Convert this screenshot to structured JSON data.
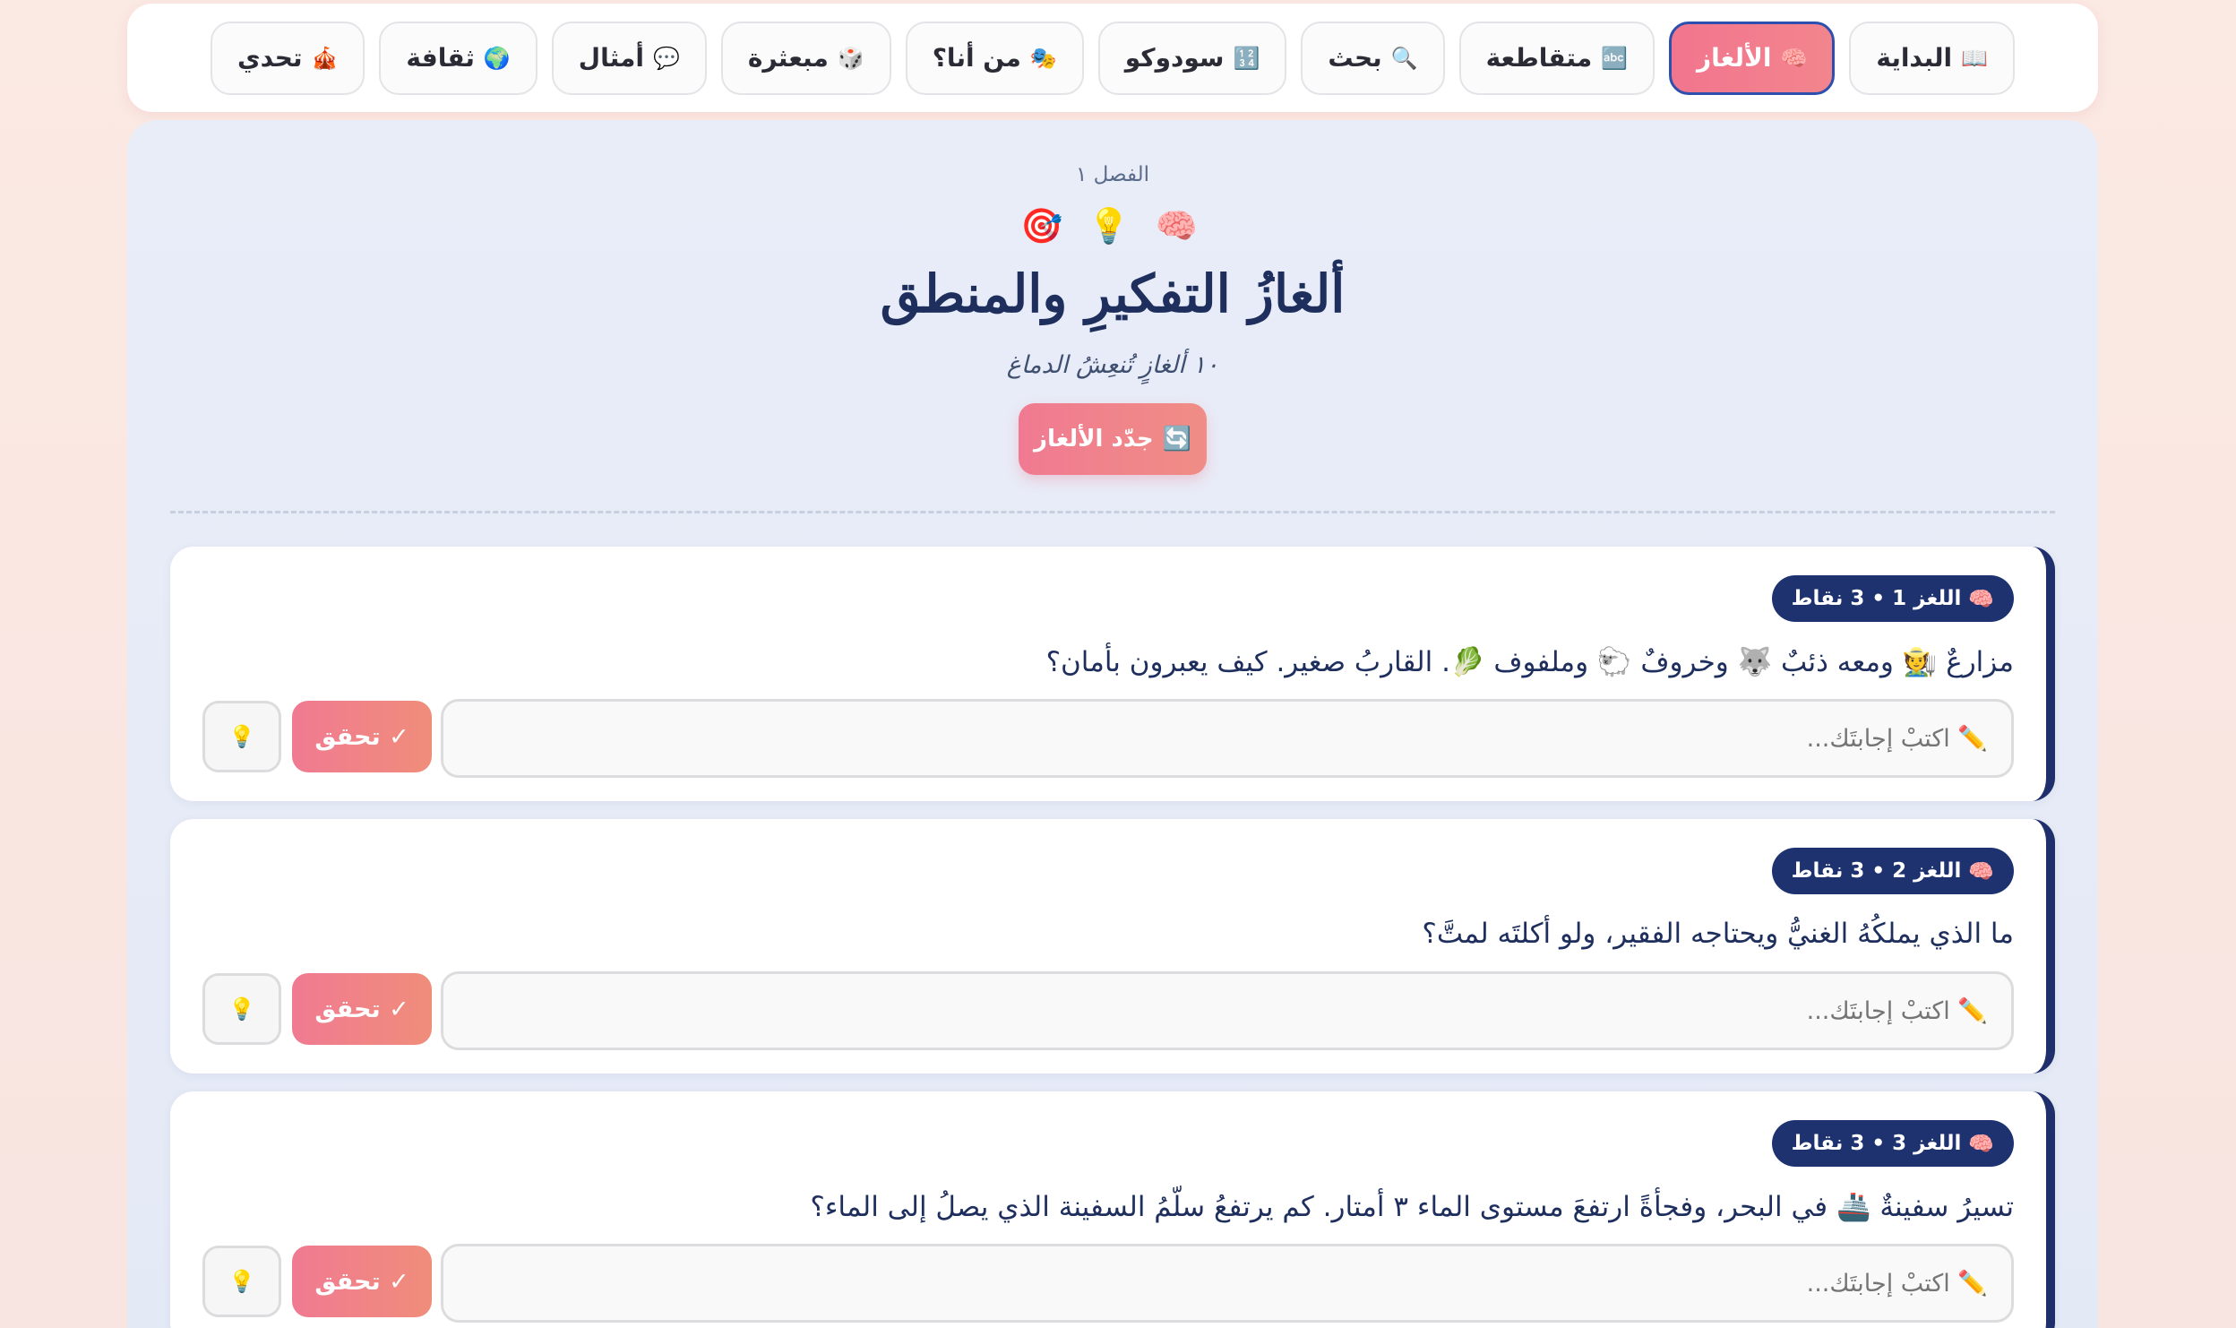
{
  "nav": {
    "items": [
      {
        "icon": "📖",
        "label": "البداية",
        "active": false
      },
      {
        "icon": "🧠",
        "label": "الألغاز",
        "active": true
      },
      {
        "icon": "🔤",
        "label": "متقاطعة",
        "active": false
      },
      {
        "icon": "🔍",
        "label": "بحث",
        "active": false
      },
      {
        "icon": "🔢",
        "label": "سودوكو",
        "active": false
      },
      {
        "icon": "🎭",
        "label": "من أنا؟",
        "active": false
      },
      {
        "icon": "🎲",
        "label": "مبعثرة",
        "active": false
      },
      {
        "icon": "💬",
        "label": "أمثال",
        "active": false
      },
      {
        "icon": "🌍",
        "label": "ثقافة",
        "active": false
      },
      {
        "icon": "🎪",
        "label": "تحدي",
        "active": false
      }
    ]
  },
  "header": {
    "chapter": "الفصل ١",
    "emojis": "🧠 💡 🎯",
    "title": "ألغازُ التفكيرِ والمنطق",
    "subtitle": "١٠ ألغازٍ تُنعِشُ الدماغ",
    "refresh_icon": "🔄",
    "refresh_label": "جدّد الألغاز"
  },
  "riddles": [
    {
      "badge_icon": "🧠",
      "badge": "اللغز 1 • 3 نقاط",
      "question": "مزارعٌ 🧑‍🌾 ومعه ذئبٌ 🐺 وخروفٌ 🐑 وملفوف 🥬. القاربُ صغير. كيف يعبرون بأمان؟",
      "placeholder": "✏️ اكتبْ إجابتَك...",
      "check_label": "✓ تحقق",
      "hint_icon": "💡"
    },
    {
      "badge_icon": "🧠",
      "badge": "اللغز 2 • 3 نقاط",
      "question": "ما الذي يملكُهُ الغنيُّ ويحتاجه الفقير، ولو أكلتَه لمتَّ؟",
      "placeholder": "✏️ اكتبْ إجابتَك...",
      "check_label": "✓ تحقق",
      "hint_icon": "💡"
    },
    {
      "badge_icon": "🧠",
      "badge": "اللغز 3 • 3 نقاط",
      "question": "تسيرُ سفينةٌ 🚢 في البحر، وفجأةً ارتفعَ مستوى الماء ٣ أمتار. كم يرتفعُ سلّمُ السفينة الذي يصلُ إلى الماء؟",
      "placeholder": "✏️ اكتبْ إجابتَك...",
      "check_label": "✓ تحقق",
      "hint_icon": "💡"
    }
  ]
}
